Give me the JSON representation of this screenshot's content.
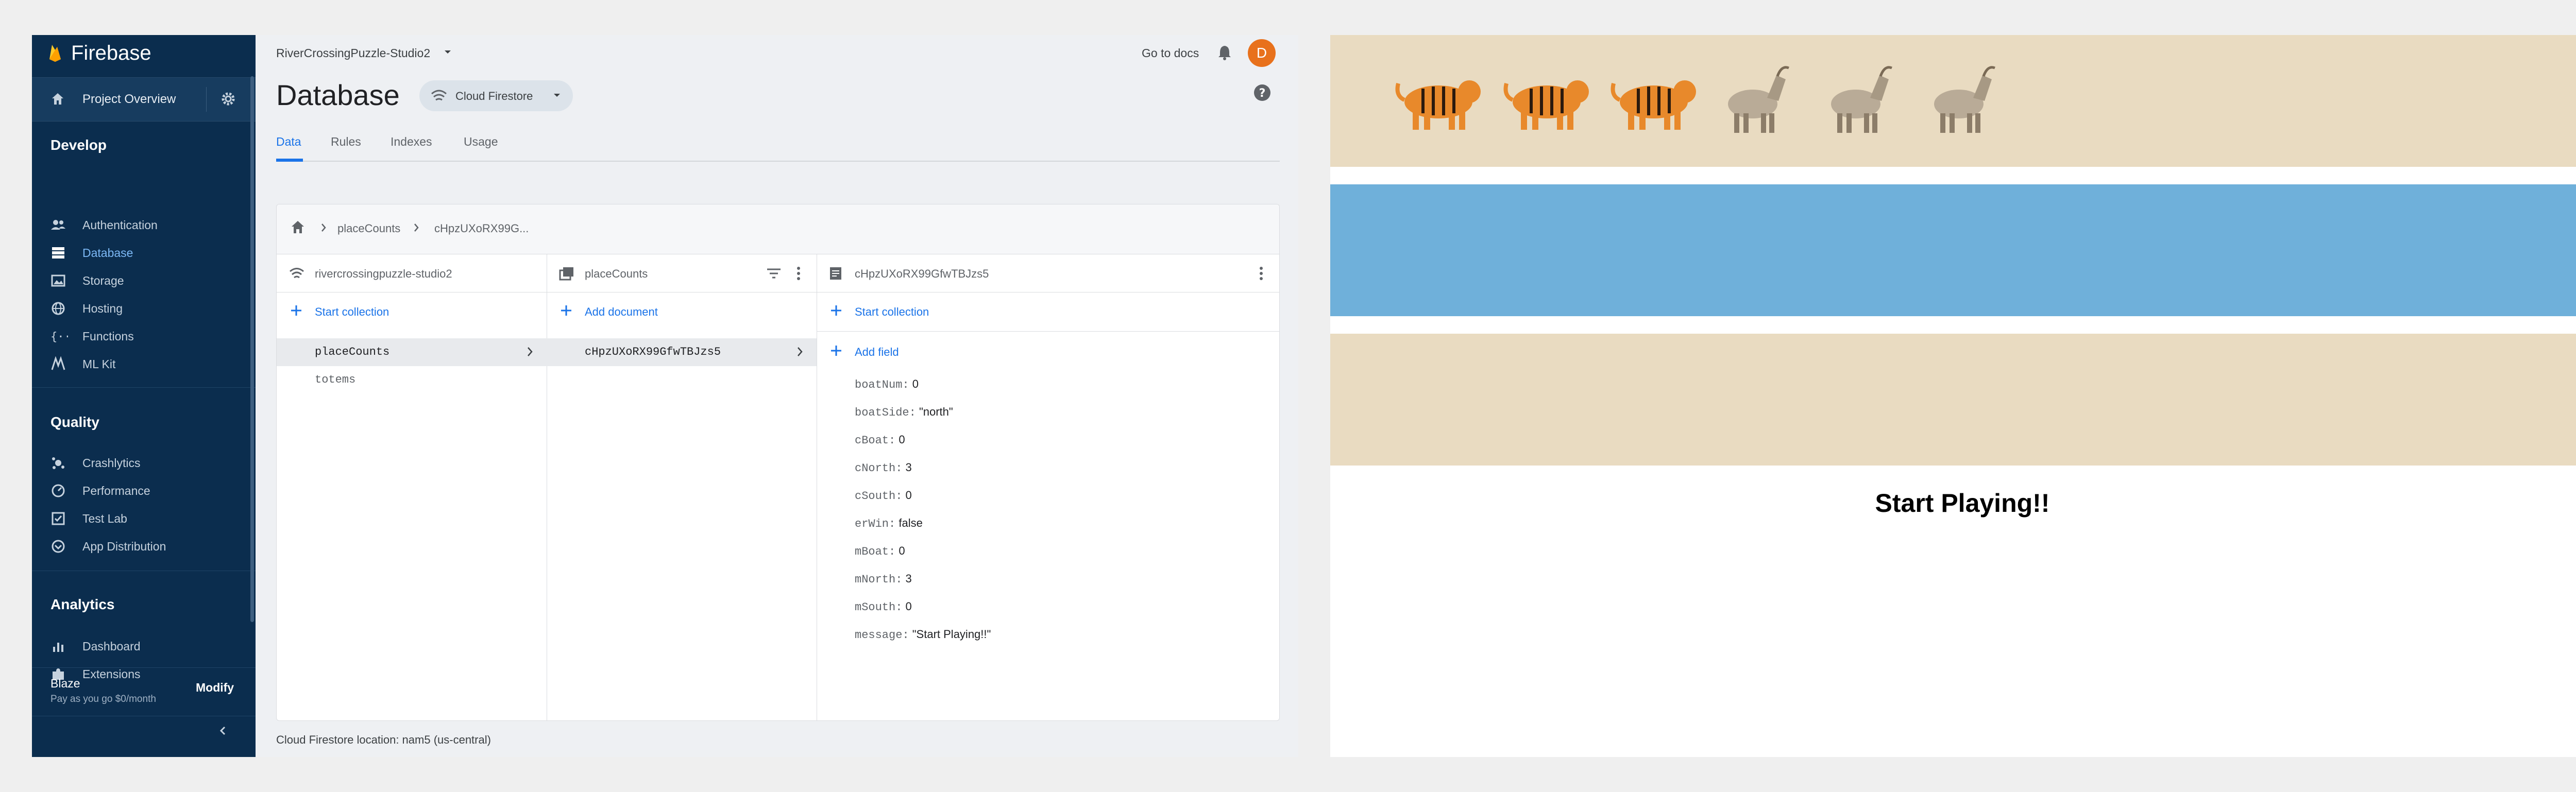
{
  "sidebar": {
    "brand": "Firebase",
    "overview": "Project Overview",
    "sections": {
      "develop": "Develop",
      "quality": "Quality",
      "analytics": "Analytics"
    },
    "develop_items": [
      "Authentication",
      "Database",
      "Storage",
      "Hosting",
      "Functions",
      "ML Kit"
    ],
    "quality_items": [
      "Crashlytics",
      "Performance",
      "Test Lab",
      "App Distribution"
    ],
    "analytics_items": [
      "Dashboard"
    ],
    "extensions": "Extensions",
    "plan_name": "Blaze",
    "plan_desc": "Pay as you go $0/month",
    "modify": "Modify",
    "active_item": "Database"
  },
  "header": {
    "project": "RiverCrossingPuzzle-Studio2",
    "docs": "Go to docs",
    "avatar_letter": "D",
    "title": "Database",
    "chip": "Cloud Firestore"
  },
  "tabs": [
    "Data",
    "Rules",
    "Indexes",
    "Usage"
  ],
  "breadcrumb": [
    "placeCounts",
    "cHpzUXoRX99G..."
  ],
  "columns": {
    "root": {
      "header": "rivercrossingpuzzle-studio2",
      "action": "Start collection",
      "rows": [
        "placeCounts",
        "totems"
      ]
    },
    "collection": {
      "header": "placeCounts",
      "action": "Add document",
      "rows": [
        "cHpzUXoRX99GfwTBJzs5"
      ]
    },
    "document": {
      "header": "cHpzUXoRX99GfwTBJzs5",
      "action": "Start collection",
      "add_field": "Add field",
      "fields": [
        {
          "key": "boatNum:",
          "value": "0"
        },
        {
          "key": "boatSide:",
          "value": "\"north\""
        },
        {
          "key": "cBoat:",
          "value": "0"
        },
        {
          "key": "cNorth:",
          "value": "3"
        },
        {
          "key": "cSouth:",
          "value": "0"
        },
        {
          "key": "erWin:",
          "value": "false"
        },
        {
          "key": "mBoat:",
          "value": "0"
        },
        {
          "key": "mNorth:",
          "value": "3"
        },
        {
          "key": "mSouth:",
          "value": "0"
        },
        {
          "key": "message:",
          "value": "\"Start Playing!!\""
        }
      ]
    }
  },
  "footer": "Cloud Firestore location: nam5 (us-central)",
  "game": {
    "animals": [
      "tiger",
      "tiger",
      "tiger",
      "goat",
      "goat",
      "goat"
    ],
    "start_text": "Start Playing!!"
  },
  "colors": {
    "sidebar_bg": "#0b2d4e",
    "accent": "#1a73e8",
    "bank": "#e9dbc1",
    "river": "#6fb0da",
    "avatar": "#e8711c"
  }
}
